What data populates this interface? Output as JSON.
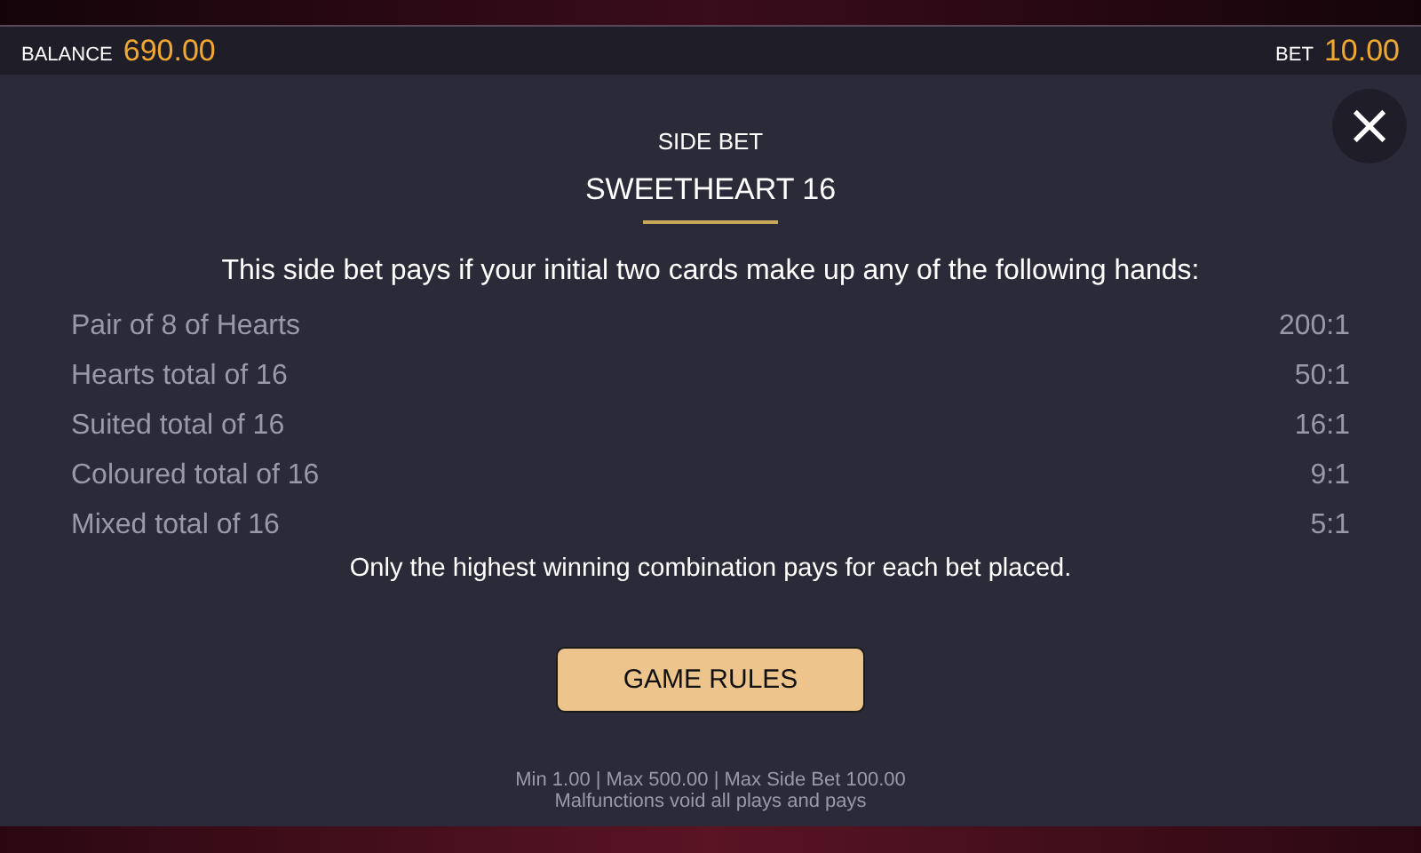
{
  "header": {
    "balance_label": "BALANCE",
    "balance": "690.00",
    "bet_label": "BET",
    "bet": "10.00"
  },
  "dialog": {
    "close": "×",
    "subtitle": "SIDE BET",
    "title": "SWEETHEART 16",
    "intro": "This side bet pays if your initial two cards make up any of the following hands:",
    "payouts": [
      {
        "hand": "Pair of 8 of Hearts",
        "pays": "200:1"
      },
      {
        "hand": "Hearts total of 16",
        "pays": "50:1"
      },
      {
        "hand": "Suited total of 16",
        "pays": "16:1"
      },
      {
        "hand": "Coloured total of 16",
        "pays": "9:1"
      },
      {
        "hand": "Mixed total of 16",
        "pays": "5:1"
      }
    ],
    "note": "Only the highest winning combination pays for each bet placed.",
    "button": "GAME RULES",
    "limits": "Min 1.00 | Max 500.00 | Max Side Bet 100.00",
    "disclaimer": "Malfunctions void all plays and pays"
  }
}
